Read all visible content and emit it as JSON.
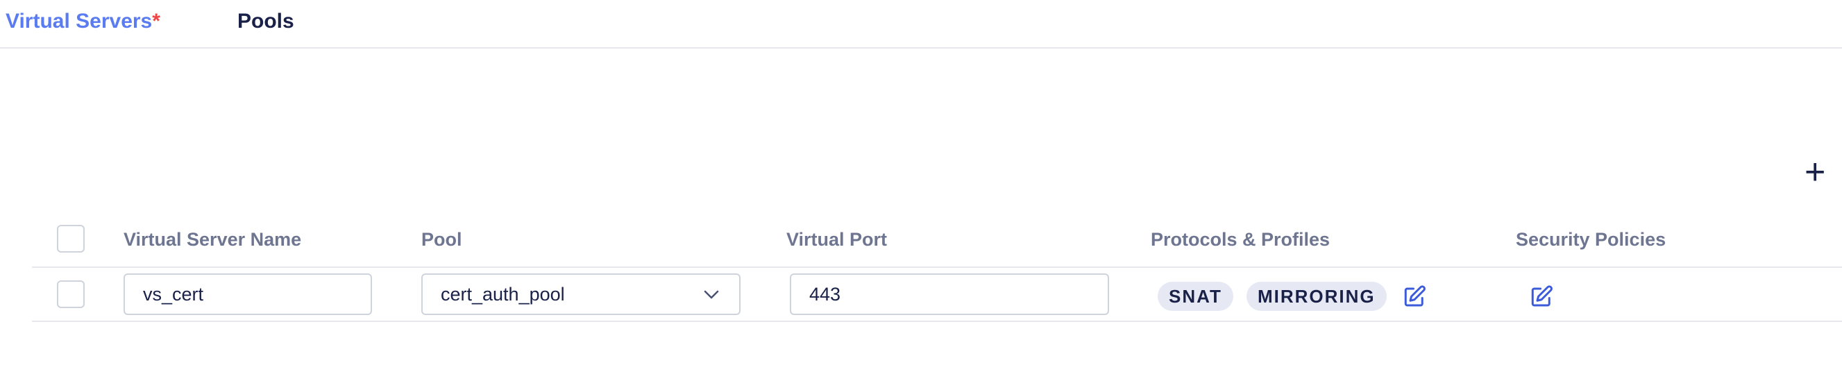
{
  "tabs": [
    {
      "label": "Virtual Servers",
      "required_mark": "*"
    },
    {
      "label": "Pools"
    }
  ],
  "add_button": {
    "icon": "plus-icon",
    "label": "+"
  },
  "table": {
    "headers": [
      "Virtual Server Name",
      "Pool",
      "Virtual Port",
      "Protocols & Profiles",
      "Security Policies"
    ],
    "rows": [
      {
        "name": "vs_cert",
        "pool": "cert_auth_pool",
        "port": "443",
        "profiles": [
          "SNAT",
          "MIRRORING"
        ]
      }
    ]
  },
  "colors": {
    "accent": "#5b7cf0",
    "required": "#ef4444",
    "text": "#1a2148",
    "header": "#6e7590",
    "badge_bg": "#e6e9f3"
  }
}
